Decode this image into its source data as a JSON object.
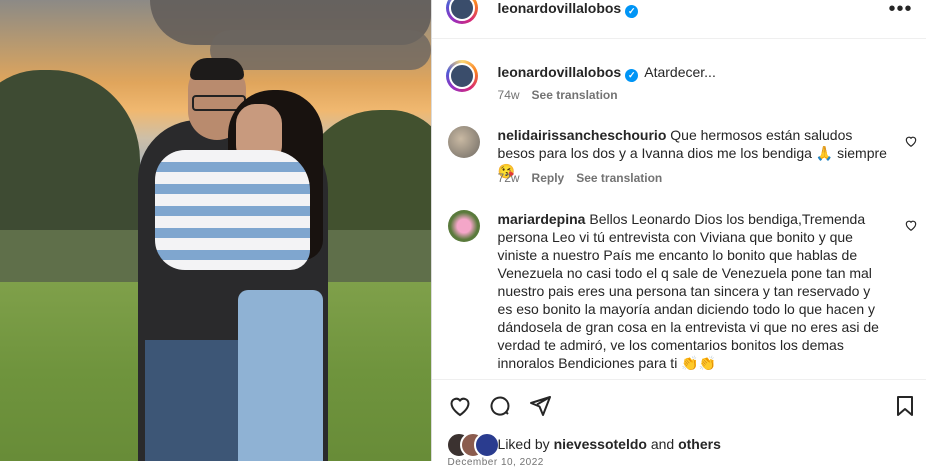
{
  "post": {
    "username": "leonardovillalobos",
    "caption": "Atardecer...",
    "caption_age": "74w",
    "see_translation": "See translation",
    "more_icon": "more-horizontal-icon"
  },
  "comments": [
    {
      "username": "nelidairissancheschourio",
      "text": "Que hermosos están saludos besos para los dos y a Ivanna dios me los bendiga 🙏 siempre 😘",
      "age": "72w",
      "reply": "Reply",
      "see_translation": "See translation"
    },
    {
      "username": "mariardepina",
      "text": "Bellos Leonardo Dios los bendiga,Tremenda persona Leo vi tú entrevista con Viviana que bonito y que viniste a nuestro País me encanto lo bonito que hablas de Venezuela no casi todo el q sale de Venezuela pone tan mal nuestro pais eres una persona tan sincera y tan reservado y es eso bonito la mayoría andan diciendo todo lo que hacen y dándosela de gran cosa en la entrevista vi que no eres asi de verdad te admiró, ve los comentarios bonitos los demas innoralos Bendiciones para ti 👏👏"
    }
  ],
  "likes": {
    "prefix": "Liked by",
    "user": "nievessoteldo",
    "and": "and",
    "others": "others"
  },
  "date": "December 10, 2022",
  "colors": {
    "verified": "#0095f6",
    "text": "#262626",
    "secondary": "#737373"
  }
}
